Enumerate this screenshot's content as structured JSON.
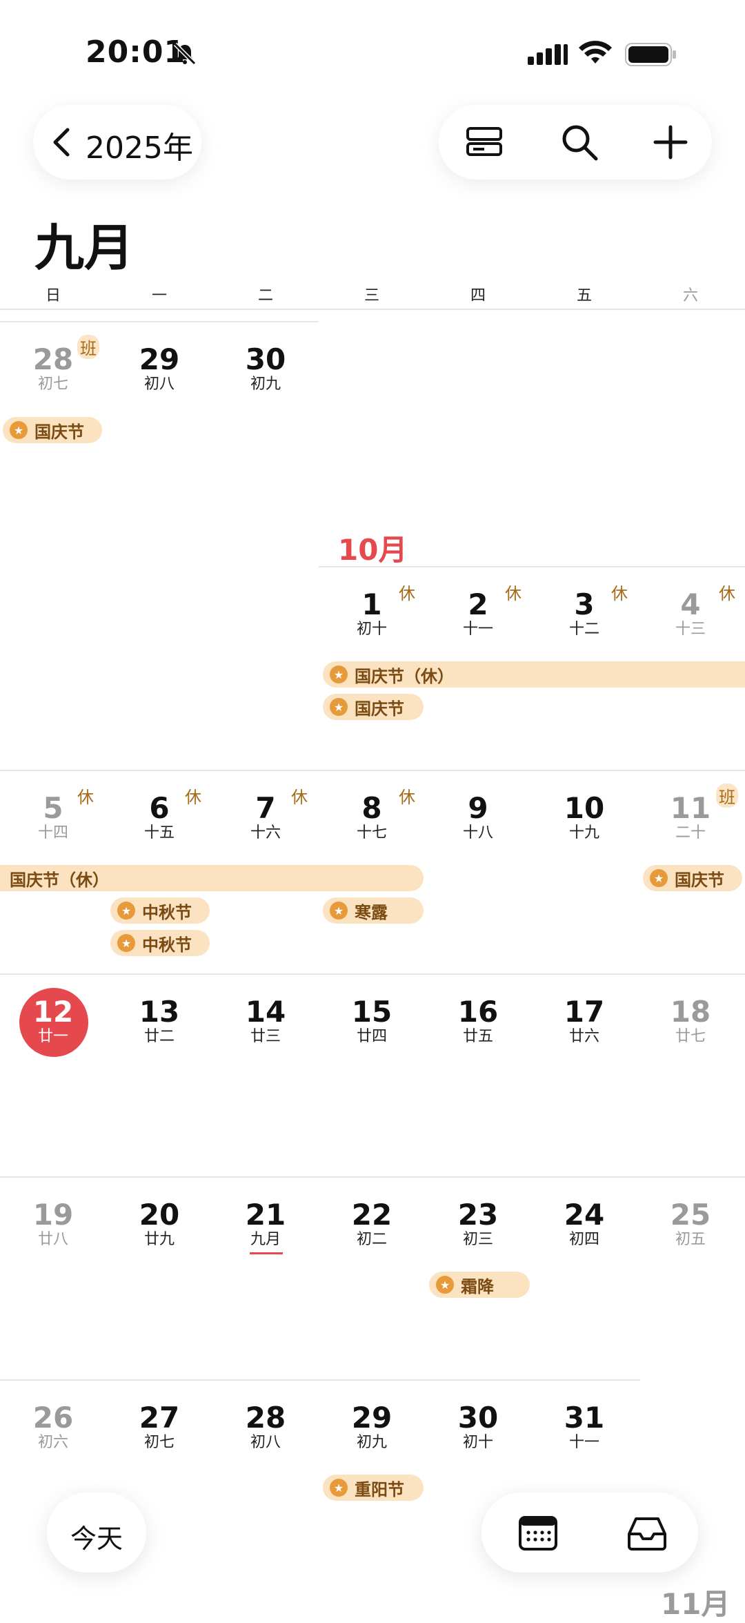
{
  "status": {
    "time": "20:01"
  },
  "header": {
    "back_label": "2025年",
    "month_title": "九月"
  },
  "weekdays": [
    "日",
    "一",
    "二",
    "三",
    "四",
    "五",
    "六"
  ],
  "sep_month_label": "10月",
  "next_month_label": "11月",
  "days": [
    {
      "num": "28",
      "lunar": "初七",
      "badge": "班"
    },
    {
      "num": "29",
      "lunar": "初八"
    },
    {
      "num": "30",
      "lunar": "初九"
    },
    {
      "num": "1",
      "lunar": "初十",
      "badge": "休"
    },
    {
      "num": "2",
      "lunar": "十一",
      "badge": "休"
    },
    {
      "num": "3",
      "lunar": "十二",
      "badge": "休"
    },
    {
      "num": "4",
      "lunar": "十三",
      "badge": "休"
    },
    {
      "num": "5",
      "lunar": "十四",
      "badge": "休"
    },
    {
      "num": "6",
      "lunar": "十五",
      "badge": "休"
    },
    {
      "num": "7",
      "lunar": "十六",
      "badge": "休"
    },
    {
      "num": "8",
      "lunar": "十七",
      "badge": "休"
    },
    {
      "num": "9",
      "lunar": "十八"
    },
    {
      "num": "10",
      "lunar": "十九"
    },
    {
      "num": "11",
      "lunar": "二十",
      "badge": "班"
    },
    {
      "num": "12",
      "lunar": "廿一"
    },
    {
      "num": "13",
      "lunar": "廿二"
    },
    {
      "num": "14",
      "lunar": "廿三"
    },
    {
      "num": "15",
      "lunar": "廿四"
    },
    {
      "num": "16",
      "lunar": "廿五"
    },
    {
      "num": "17",
      "lunar": "廿六"
    },
    {
      "num": "18",
      "lunar": "廿七"
    },
    {
      "num": "19",
      "lunar": "廿八"
    },
    {
      "num": "20",
      "lunar": "廿九"
    },
    {
      "num": "21",
      "lunar": "九月"
    },
    {
      "num": "22",
      "lunar": "初二"
    },
    {
      "num": "23",
      "lunar": "初三"
    },
    {
      "num": "24",
      "lunar": "初四"
    },
    {
      "num": "25",
      "lunar": "初五"
    },
    {
      "num": "26",
      "lunar": "初六"
    },
    {
      "num": "27",
      "lunar": "初七"
    },
    {
      "num": "28",
      "lunar": "初八"
    },
    {
      "num": "29",
      "lunar": "初九"
    },
    {
      "num": "30",
      "lunar": "初十"
    },
    {
      "num": "31",
      "lunar": "十一"
    }
  ],
  "events": [
    "国庆节",
    "国庆节（休）",
    "国庆节",
    "国庆节（休）",
    "中秋节",
    "中秋节",
    "寒露",
    "国庆节",
    "霜降",
    "重阳节"
  ],
  "bottom": {
    "today_label": "今天"
  }
}
